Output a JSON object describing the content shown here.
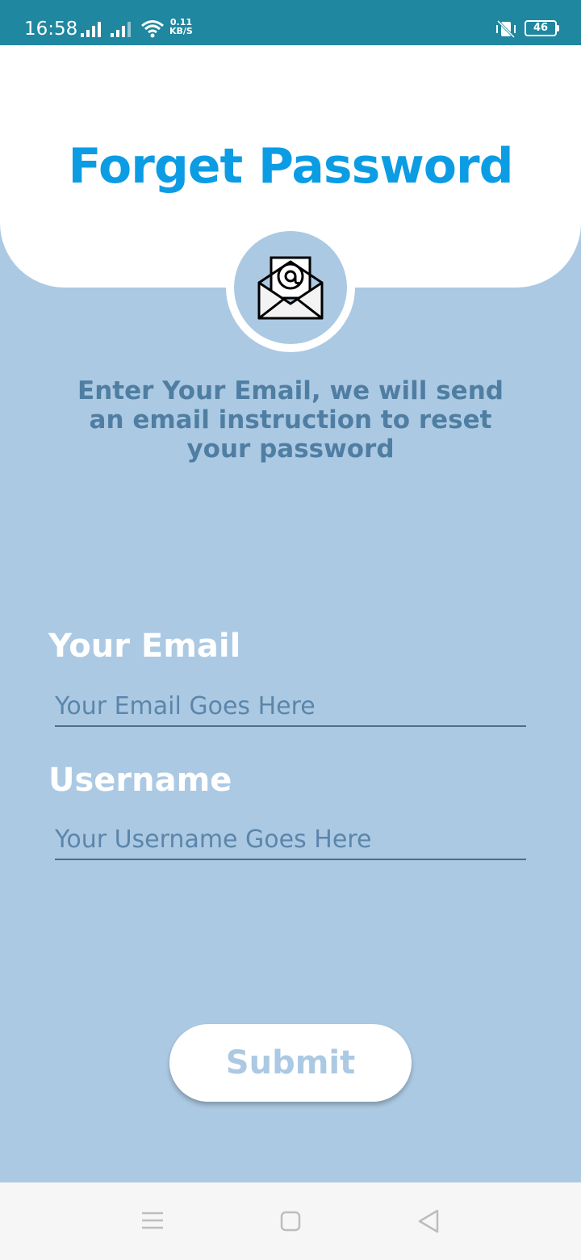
{
  "status_bar": {
    "time": "16:58",
    "net_speed_value": "0.11",
    "net_speed_unit": "KB/S",
    "battery": "46",
    "icons": [
      "signal-icon",
      "signal-icon",
      "wifi-icon",
      "vibrate-icon",
      "battery-icon"
    ]
  },
  "header": {
    "title": "Forget Password",
    "title_color": "#0c9ce4",
    "icon": "email-envelope-icon"
  },
  "instruction": "Enter Your Email, we will send an email instruction to reset your password",
  "form": {
    "email": {
      "label": "Your Email",
      "placeholder": "Your Email Goes Here",
      "value": ""
    },
    "username": {
      "label": "Username",
      "placeholder": "Your Username Goes Here",
      "value": ""
    },
    "submit_label": "Submit"
  },
  "nav_bar": {
    "icons": [
      "menu-icon",
      "home-square-icon",
      "back-triangle-icon"
    ]
  },
  "colors": {
    "background": "#acc9e3",
    "status_bar": "#1f879f",
    "accent": "#0c9ce4",
    "instruction_text": "#4f7ea2"
  }
}
